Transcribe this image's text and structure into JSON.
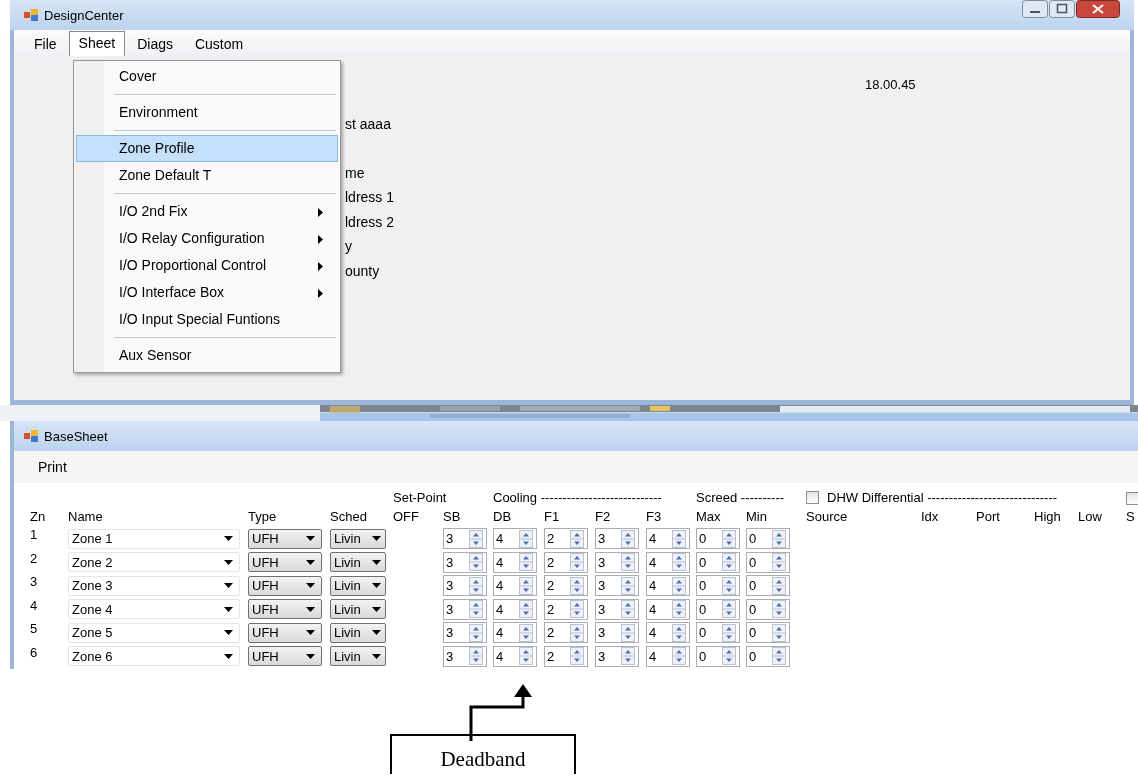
{
  "design_center": {
    "title": "DesignCenter",
    "menu": [
      {
        "label": "File",
        "selected": false
      },
      {
        "label": "Sheet",
        "selected": true
      },
      {
        "label": "Diags",
        "selected": false
      },
      {
        "label": "Custom",
        "selected": false
      }
    ],
    "time": "18.00.45",
    "partial_labels": [
      "st aaaa",
      "me",
      "ldress 1",
      "ldress 2",
      "y",
      "ounty"
    ],
    "sheet_menu": [
      [
        {
          "label": "Cover",
          "selected": false,
          "submenu": false
        }
      ],
      [
        {
          "label": "Environment",
          "selected": false,
          "submenu": false
        }
      ],
      [
        {
          "label": "Zone Profile",
          "selected": true,
          "submenu": false
        },
        {
          "label": "Zone Default T",
          "selected": false,
          "submenu": false
        }
      ],
      [
        {
          "label": "I/O 2nd Fix",
          "selected": false,
          "submenu": true
        },
        {
          "label": "I/O Relay Configuration",
          "selected": false,
          "submenu": true
        },
        {
          "label": "I/O Proportional Control",
          "selected": false,
          "submenu": true
        },
        {
          "label": "I/O Interface Box",
          "selected": false,
          "submenu": true
        },
        {
          "label": "I/O Input Special Funtions",
          "selected": false,
          "submenu": false
        }
      ],
      [
        {
          "label": "Aux Sensor",
          "selected": false,
          "submenu": false
        }
      ]
    ]
  },
  "base_sheet": {
    "title": "BaseSheet",
    "menu": [
      "Print"
    ],
    "groups": {
      "set_point": "Set-Point",
      "cooling": "Cooling ----------------------------",
      "screed": "Screed ----------",
      "dhw": {
        "label": "DHW Differential ------------------------------",
        "checked": false
      },
      "cut_checkbox": {
        "checked": false
      }
    },
    "columns": [
      "Zn",
      "Name",
      "Type",
      "Sched",
      "OFF",
      "SB",
      "DB",
      "F1",
      "F2",
      "F3",
      "Max",
      "Min",
      "Source",
      "Idx",
      "Port",
      "High",
      "Low",
      "S"
    ],
    "rows": [
      {
        "zn": "1",
        "name": "Zone 1",
        "type": "UFH",
        "sched": "Livin",
        "sb": "3",
        "db": "4",
        "f1": "2",
        "f2": "3",
        "f3": "4",
        "max": "0",
        "min": "0"
      },
      {
        "zn": "2",
        "name": "Zone 2",
        "type": "UFH",
        "sched": "Livin",
        "sb": "3",
        "db": "4",
        "f1": "2",
        "f2": "3",
        "f3": "4",
        "max": "0",
        "min": "0"
      },
      {
        "zn": "3",
        "name": "Zone 3",
        "type": "UFH",
        "sched": "Livin",
        "sb": "3",
        "db": "4",
        "f1": "2",
        "f2": "3",
        "f3": "4",
        "max": "0",
        "min": "0"
      },
      {
        "zn": "4",
        "name": "Zone 4",
        "type": "UFH",
        "sched": "Livin",
        "sb": "3",
        "db": "4",
        "f1": "2",
        "f2": "3",
        "f3": "4",
        "max": "0",
        "min": "0"
      },
      {
        "zn": "5",
        "name": "Zone 5",
        "type": "UFH",
        "sched": "Livin",
        "sb": "3",
        "db": "4",
        "f1": "2",
        "f2": "3",
        "f3": "4",
        "max": "0",
        "min": "0"
      },
      {
        "zn": "6",
        "name": "Zone 6",
        "type": "UFH",
        "sched": "Livin",
        "sb": "3",
        "db": "4",
        "f1": "2",
        "f2": "3",
        "f3": "4",
        "max": "0",
        "min": "0"
      }
    ]
  },
  "annotation": {
    "label": "Deadband"
  }
}
